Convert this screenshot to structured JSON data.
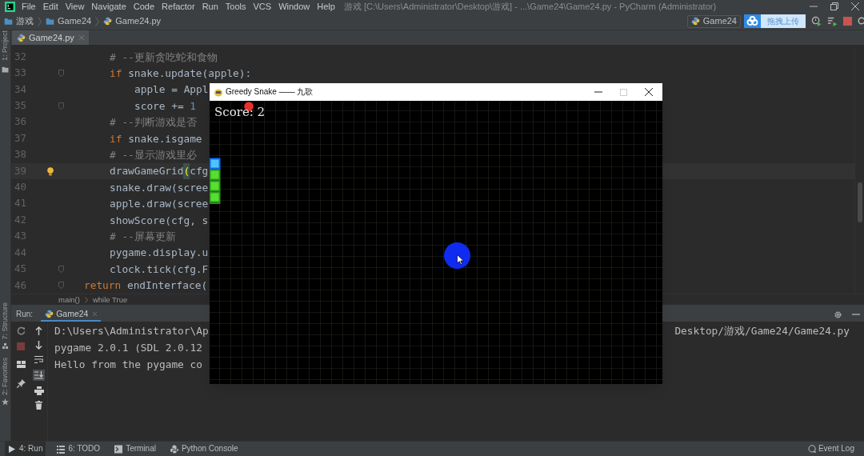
{
  "menu_bar": {
    "items": [
      "File",
      "Edit",
      "View",
      "Navigate",
      "Code",
      "Refactor",
      "Run",
      "Tools",
      "VCS",
      "Window",
      "Help"
    ],
    "window_title": "游戏 [C:\\Users\\Administrator\\Desktop\\游戏] - ...\\Game24\\Game24.py - PyCharm (Administrator)"
  },
  "breadcrumb": [
    {
      "label": "游戏",
      "kind": "folder"
    },
    {
      "label": "Game24",
      "kind": "folder"
    },
    {
      "label": "Game24.py",
      "kind": "file"
    }
  ],
  "run_configuration": "Game24",
  "upload_widget": "拖拽上传",
  "editor_tabs": [
    {
      "label": "Game24.py",
      "selected": true
    }
  ],
  "tool_stripe": {
    "top": [
      "1: Project"
    ],
    "bottom": [
      "7: Structure",
      "2: Favorites"
    ]
  },
  "code_lines": [
    {
      "number": "32",
      "current": false,
      "fold": false,
      "outdent": false,
      "segments": [
        {
          "kind": "comment",
          "text": "# --更新贪吃蛇和食物"
        }
      ]
    },
    {
      "number": "33",
      "current": false,
      "fold": true,
      "outdent": false,
      "segments": [
        {
          "kind": "keyword",
          "text": "if"
        },
        {
          "kind": "plain",
          "text": " snake.update(apple):"
        }
      ],
      "children": [
        {
          "number": "34",
          "current": false,
          "fold": false,
          "outdent": false,
          "segments": [
            {
              "kind": "plain",
              "text": "apple = Appl"
            }
          ]
        },
        {
          "number": "35",
          "current": false,
          "fold": true,
          "outdent": false,
          "segments": [
            {
              "kind": "plain",
              "text": "score += "
            },
            {
              "kind": "number",
              "text": "1"
            }
          ]
        }
      ]
    },
    {
      "number": "36",
      "current": false,
      "fold": false,
      "outdent": false,
      "segments": [
        {
          "kind": "comment",
          "text": "# --判断游戏是否"
        }
      ]
    },
    {
      "number": "37",
      "current": false,
      "fold": false,
      "outdent": false,
      "segments": [
        {
          "kind": "keyword",
          "text": "if"
        },
        {
          "kind": "plain",
          "text": " snake.isgame"
        }
      ]
    },
    {
      "number": "38",
      "current": false,
      "fold": false,
      "outdent": false,
      "segments": [
        {
          "kind": "comment",
          "text": "# --显示游戏里必"
        }
      ]
    },
    {
      "number": "39",
      "current": true,
      "fold": false,
      "outdent": false,
      "segments": [
        {
          "kind": "plain",
          "text": "drawGameGrid"
        },
        {
          "kind": "bracket",
          "text": "("
        },
        {
          "kind": "plain",
          "text": "cfg"
        }
      ]
    },
    {
      "number": "40",
      "current": false,
      "fold": false,
      "outdent": false,
      "segments": [
        {
          "kind": "plain",
          "text": "snake.draw(scree"
        }
      ]
    },
    {
      "number": "41",
      "current": false,
      "fold": false,
      "outdent": false,
      "segments": [
        {
          "kind": "plain",
          "text": "apple.draw(scree"
        }
      ]
    },
    {
      "number": "42",
      "current": false,
      "fold": false,
      "outdent": false,
      "segments": [
        {
          "kind": "plain",
          "text": "showScore(cfg, s"
        }
      ]
    },
    {
      "number": "43",
      "current": false,
      "fold": false,
      "outdent": false,
      "segments": [
        {
          "kind": "comment",
          "text": "# --屏幕更新"
        }
      ]
    },
    {
      "number": "44",
      "current": false,
      "fold": false,
      "outdent": false,
      "segments": [
        {
          "kind": "plain",
          "text": "pygame.display.u"
        }
      ]
    },
    {
      "number": "45",
      "current": false,
      "fold": true,
      "outdent": false,
      "segments": [
        {
          "kind": "plain",
          "text": "clock.tick(cfg.F"
        }
      ]
    },
    {
      "number": "46",
      "current": false,
      "fold": true,
      "outdent": true,
      "segments": [
        {
          "kind": "keyword",
          "text": "return"
        },
        {
          "kind": "plain",
          "text": " endInterface("
        }
      ]
    }
  ],
  "code_breadcrumb": [
    "main()",
    "while True"
  ],
  "run_panel": {
    "label": "Run:",
    "tabs": [
      {
        "label": "Game24",
        "selected": true
      }
    ],
    "output": [
      [
        "D:\\Users\\Administrator\\Ap",
        "Desktop/游戏/Game24/Game24.py"
      ],
      [
        "pygame 2.0.1 (SDL 2.0.12"
      ],
      [
        "Hello from the pygame co"
      ]
    ]
  },
  "bottom_tabs": [
    {
      "label": "4: Run",
      "kind": "run",
      "selected": true
    },
    {
      "label": "6: TODO",
      "kind": "todo",
      "selected": false
    },
    {
      "label": "Terminal",
      "kind": "terminal",
      "selected": false
    },
    {
      "label": "Python Console",
      "kind": "console",
      "selected": false
    }
  ],
  "event_log": "Event Log",
  "game_window": {
    "title": "Greedy Snake —— 九歌",
    "score": "Score: 2"
  }
}
